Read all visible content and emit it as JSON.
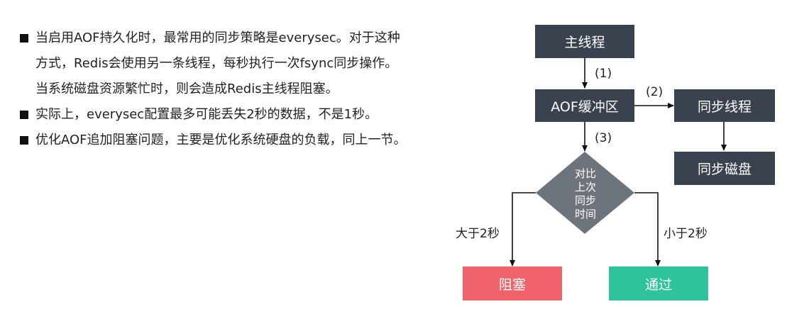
{
  "bullets": [
    {
      "lines": [
        "当启用AOF持久化时，最常用的同步策略是everysec。对于这种",
        "方式，Redis会使用另一条线程，每秒执行一次fsync同步操作。",
        "当系统磁盘资源繁忙时，则会造成Redis主线程阻塞。"
      ]
    },
    {
      "lines": [
        "实际上，everysec配置最多可能丢失2秒的数据，不是1秒。"
      ]
    },
    {
      "lines": [
        "优化AOF追加阻塞问题，主要是优化系统硬盘的负载，同上一节。"
      ]
    }
  ],
  "flow": {
    "main_thread": "主线程",
    "aof_buffer": "AOF缓冲区",
    "sync_thread": "同步线程",
    "sync_disk": "同步磁盘",
    "decision_lines": [
      "对比",
      "上次",
      "同步",
      "时间"
    ],
    "block": "阻塞",
    "pass": "通过",
    "edge_1": "(1)",
    "edge_2": "(2)",
    "edge_3": "(3)",
    "greater_label": "大于2秒",
    "less_label": "小于2秒"
  },
  "colors": {
    "node_dark": "#3a4250",
    "diamond": "#6e747c",
    "block": "#f0636a",
    "pass": "#2fc39c"
  }
}
